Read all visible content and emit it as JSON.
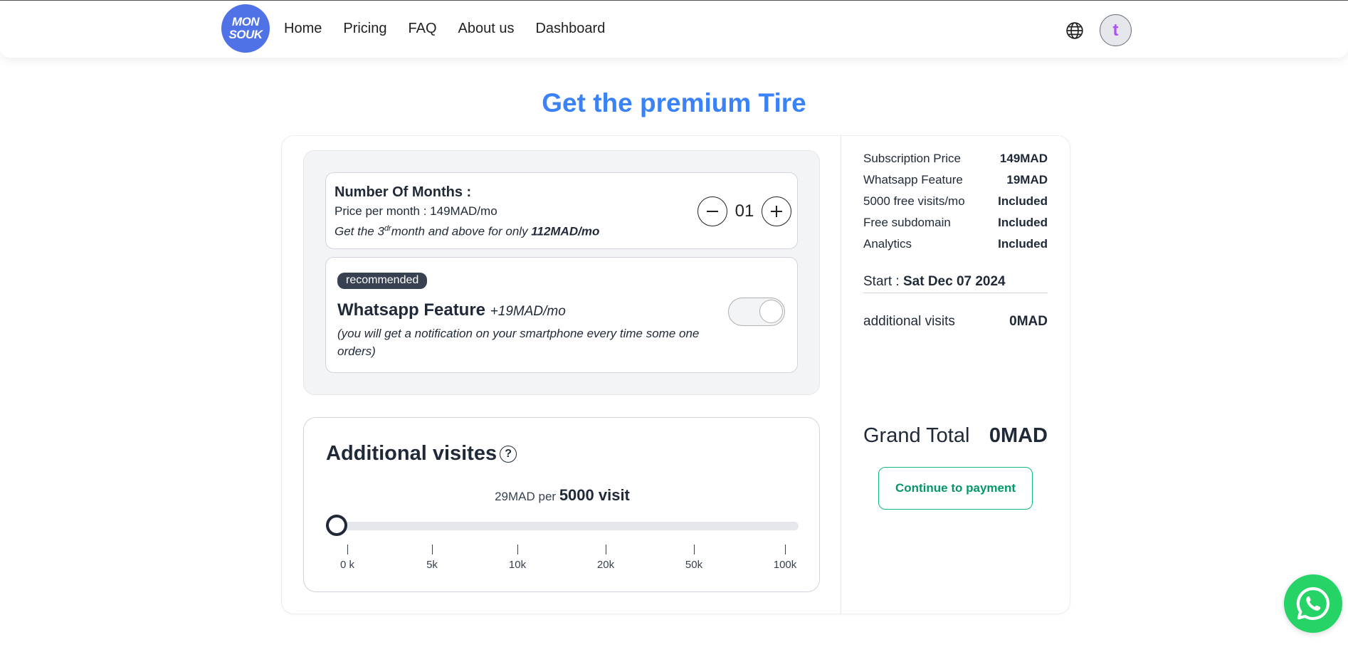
{
  "brand": {
    "logo_line1": "MON",
    "logo_line2": "SOUK"
  },
  "nav": {
    "items": [
      "Home",
      "Pricing",
      "FAQ",
      "About us",
      "Dashboard"
    ]
  },
  "user": {
    "avatar_letter": "t"
  },
  "page": {
    "title": "Get the premium Tire"
  },
  "months": {
    "title": "Number Of Months :",
    "price_per_month": "Price per month : 149MAD/mo",
    "promo_prefix": "Get the 3",
    "promo_sup": "dr",
    "promo_mid": "month and above for only ",
    "promo_price": "112MAD/mo",
    "value": "01"
  },
  "whatsapp_feature": {
    "badge": "recommended",
    "title": "Whatsapp Feature",
    "price": "+19MAD/mo",
    "description": "(you will get a notification on your smartphone every time some one orders)",
    "enabled": false
  },
  "visits": {
    "title": "Additional visites",
    "price_prefix": "29MAD per",
    "price_amount": "5000 visit",
    "ticks": [
      "0 k",
      "5k",
      "10k",
      "20k",
      "50k",
      "100k"
    ],
    "selected_index": 0
  },
  "summary": {
    "rows": [
      {
        "label": "Subscription Price",
        "value": "149MAD"
      },
      {
        "label": "Whatsapp Feature",
        "value": "19MAD"
      },
      {
        "label": "5000 free visits/mo",
        "value": "Included"
      },
      {
        "label": "Free subdomain",
        "value": "Included"
      },
      {
        "label": "Analytics",
        "value": "Included"
      }
    ],
    "start_label": "Start :",
    "start_date": "Sat Dec 07 2024",
    "additional_label": "additional visits",
    "additional_value": "0MAD",
    "grand_label": "Grand Total",
    "grand_value": "0MAD",
    "pay_button": "Continue to payment"
  },
  "colors": {
    "accent": "#3b82f6",
    "logo_bg": "#4f72e6",
    "pay": "#10b981",
    "whatsapp": "#25d366"
  }
}
